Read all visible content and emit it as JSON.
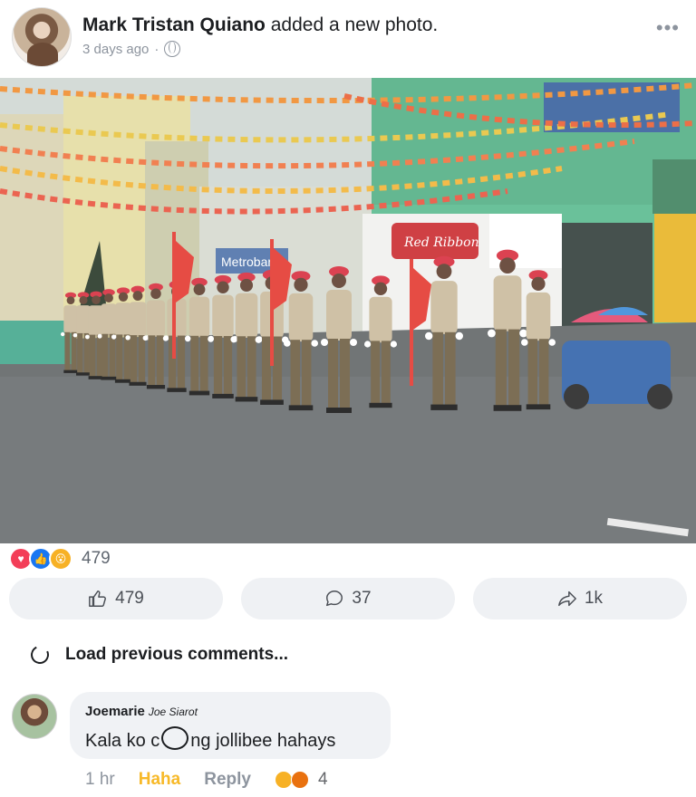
{
  "post": {
    "author": "Mark Tristan Quiano",
    "action": "added a new photo.",
    "time": "3 days ago",
    "separator": "·",
    "audience_icon": "globe-icon",
    "more_icon": "ellipsis-icon"
  },
  "photo": {
    "storefront_sign": "Red Ribbon",
    "bank_sign": "Metrobank"
  },
  "reactions": {
    "types": [
      "love",
      "like",
      "wow"
    ],
    "count": "479"
  },
  "actions": {
    "like_count": "479",
    "comment_count": "37",
    "share_count": "1k"
  },
  "comments": {
    "load_previous": "Load previous comments...",
    "items": [
      {
        "author": "Joemarie",
        "alias": "Joe Siarot",
        "text_before": "Kala ko c",
        "text_after": "ng jollibee hahays",
        "time": "1 hr",
        "reaction_label": "Haha",
        "reply_label": "Reply",
        "reaction_count": "4"
      }
    ]
  },
  "colors": {
    "like_blue": "#1877f2",
    "love_red": "#f33e58",
    "wow_yellow": "#f7b125",
    "haha_text": "#f7b928",
    "secondary_text": "#8d949e",
    "button_bg": "#eff1f4"
  }
}
